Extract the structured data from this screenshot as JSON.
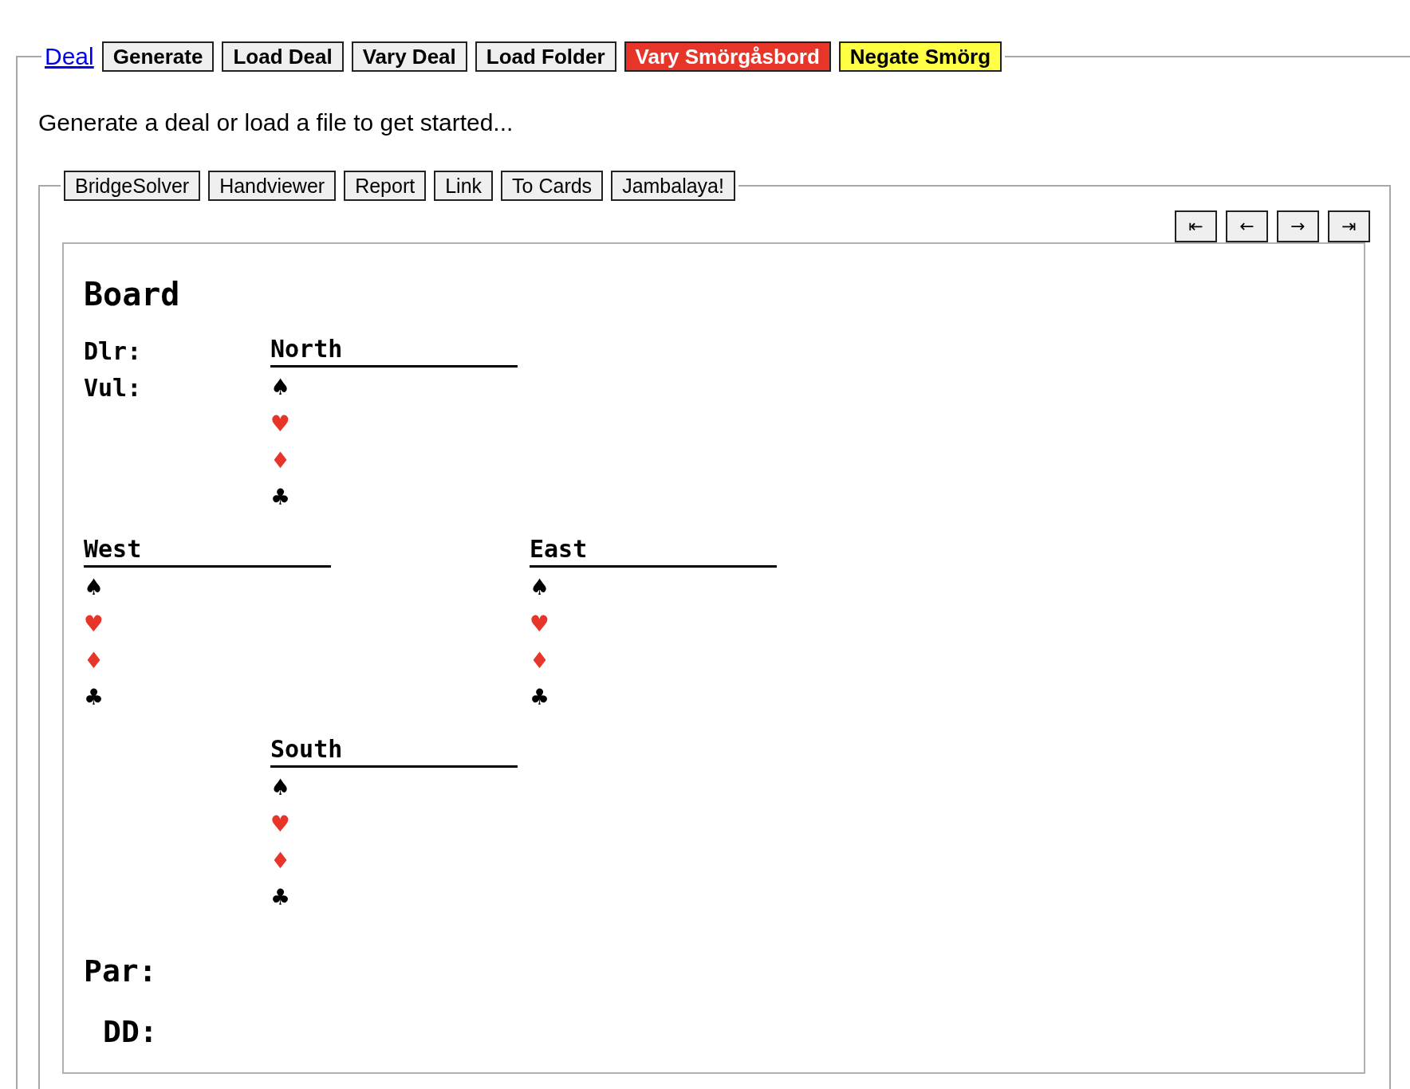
{
  "toolbar": {
    "link": "Deal",
    "buttons": [
      {
        "label": "Generate",
        "kind": "plain"
      },
      {
        "label": "Load Deal",
        "kind": "plain"
      },
      {
        "label": "Vary Deal",
        "kind": "plain"
      },
      {
        "label": "Load Folder",
        "kind": "plain"
      },
      {
        "label": "Vary Smörgåsbord",
        "kind": "red"
      },
      {
        "label": "Negate Smörg",
        "kind": "yellow"
      }
    ]
  },
  "message": "Generate a deal or load a file to get started...",
  "export_buttons": [
    "BridgeSolver",
    "Handviewer",
    "Report",
    "Link",
    "To Cards",
    "Jambalaya!"
  ],
  "nav_buttons": [
    "⇤",
    "←",
    "→",
    "⇥"
  ],
  "board": {
    "title": "Board",
    "dealer_label": "Dlr:",
    "vul_label": "Vul:",
    "hands": [
      {
        "name": "North",
        "suits": [
          {
            "symbol": "♠",
            "color": "#000000"
          },
          {
            "symbol": "♥",
            "color": "#e8352a"
          },
          {
            "symbol": "♦",
            "color": "#e8352a"
          },
          {
            "symbol": "♣",
            "color": "#000000"
          }
        ]
      },
      {
        "name": "West",
        "suits": [
          {
            "symbol": "♠",
            "color": "#000000"
          },
          {
            "symbol": "♥",
            "color": "#e8352a"
          },
          {
            "symbol": "♦",
            "color": "#e8352a"
          },
          {
            "symbol": "♣",
            "color": "#000000"
          }
        ]
      },
      {
        "name": "East",
        "suits": [
          {
            "symbol": "♠",
            "color": "#000000"
          },
          {
            "symbol": "♥",
            "color": "#e8352a"
          },
          {
            "symbol": "♦",
            "color": "#e8352a"
          },
          {
            "symbol": "♣",
            "color": "#000000"
          }
        ]
      },
      {
        "name": "South",
        "suits": [
          {
            "symbol": "♠",
            "color": "#000000"
          },
          {
            "symbol": "♥",
            "color": "#e8352a"
          },
          {
            "symbol": "♦",
            "color": "#e8352a"
          },
          {
            "symbol": "♣",
            "color": "#000000"
          }
        ]
      }
    ],
    "par_label": "Par:",
    "dd_label": "DD:"
  }
}
